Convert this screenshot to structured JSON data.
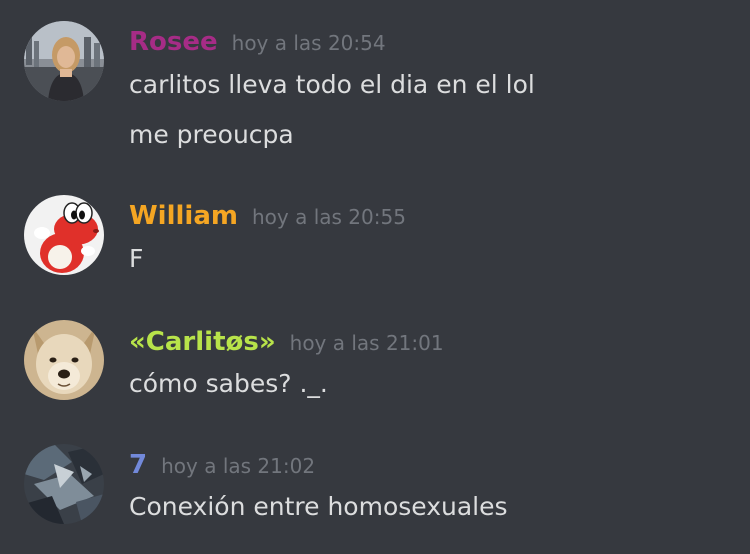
{
  "messages": [
    {
      "author": "Rosee",
      "author_color": "#a62c86",
      "timestamp": "hoy a las 20:54",
      "avatar_icon": "woman-photo-avatar",
      "lines": [
        "carlitos lleva todo el dia en el lol",
        "me preoucpa"
      ]
    },
    {
      "author": "William",
      "author_color": "#f5a623",
      "timestamp": "hoy a las 20:55",
      "avatar_icon": "red-yoshi-avatar",
      "lines": [
        "F"
      ]
    },
    {
      "author": "«Carlitøs»",
      "author_color": "#b8e34a",
      "timestamp": "hoy a las 21:01",
      "avatar_icon": "dog-photo-avatar",
      "lines": [
        "cómo sabes? ._."
      ]
    },
    {
      "author": "7",
      "author_color": "#7289da",
      "timestamp": "hoy a las 21:02",
      "avatar_icon": "dark-photo-avatar",
      "lines": [
        "Conexión entre homosexuales"
      ]
    }
  ]
}
